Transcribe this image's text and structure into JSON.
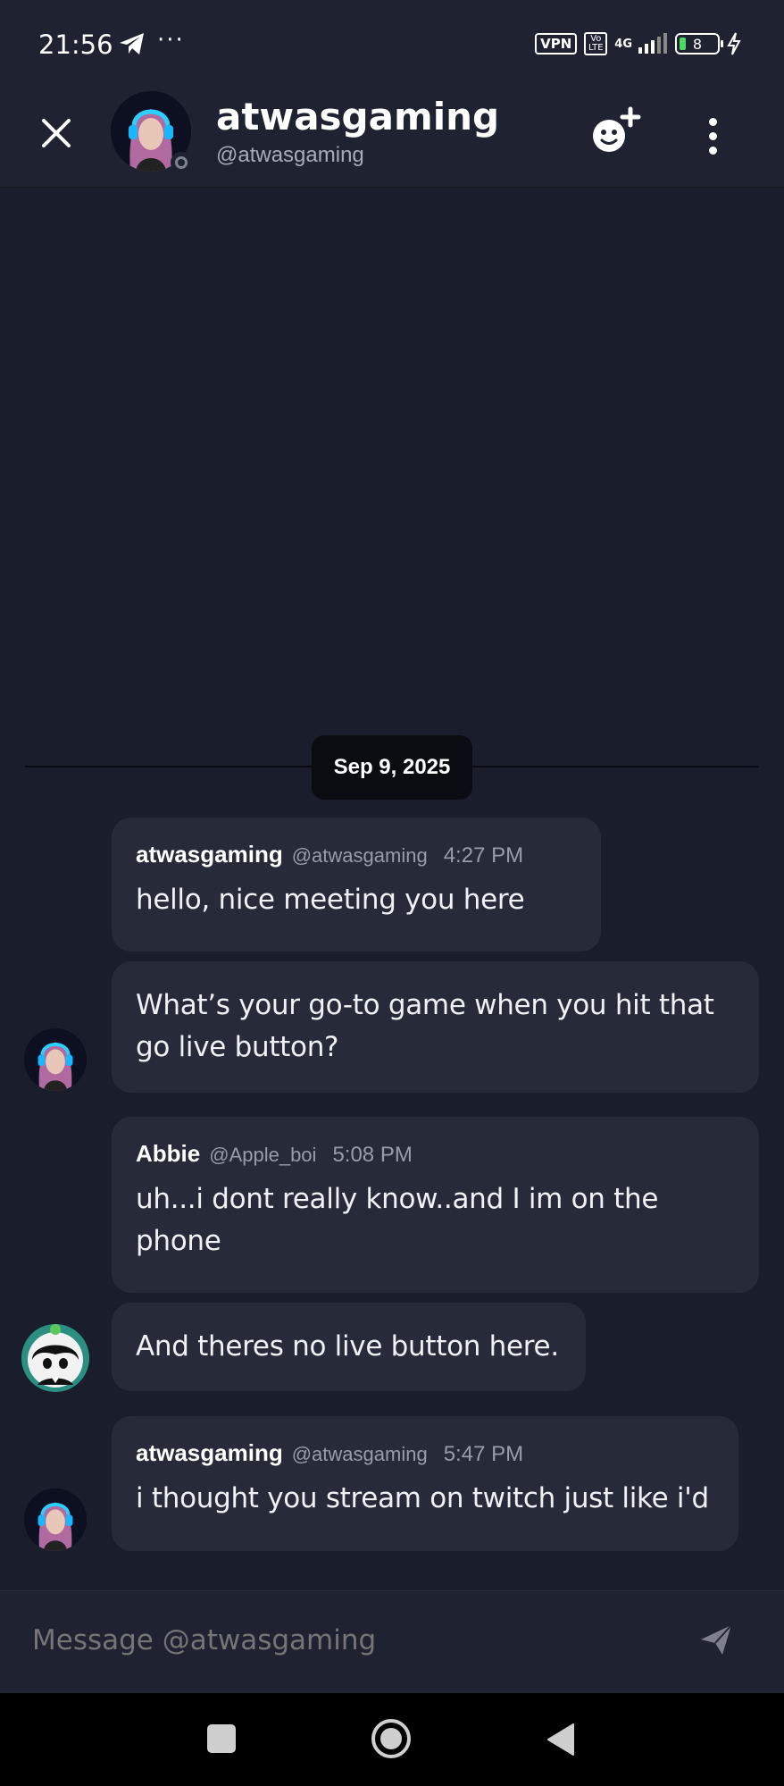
{
  "status_bar": {
    "time": "21:56",
    "overflow": "···",
    "vpn": "VPN",
    "volte": "Vo LTE",
    "network": "4G",
    "battery": "8"
  },
  "header": {
    "display_name": "atwasgaming",
    "handle": "@atwasgaming",
    "presence": "offline"
  },
  "conversation": {
    "date_divider": "Sep 9, 2025",
    "groups": [
      {
        "author": "atwasgaming",
        "handle": "@atwasgaming",
        "time": "4:27 PM",
        "messages": [
          "hello, nice meeting you here",
          "What’s your go-to game when you hit that go live button?"
        ]
      },
      {
        "author": "Abbie",
        "handle": "@Apple_boi",
        "time": "5:08 PM",
        "messages": [
          "uh...i dont really know..and I im on the phone",
          "And theres no live button here."
        ]
      },
      {
        "author": "atwasgaming",
        "handle": "@atwasgaming",
        "time": "5:47 PM",
        "messages": [
          "i thought you stream on twitch just like i'd"
        ]
      }
    ]
  },
  "composer": {
    "placeholder": "Message @atwasgaming"
  },
  "colors": {
    "background": "#1a1d2b",
    "bubble": "#272a39",
    "header": "#1f2230"
  },
  "icons": [
    "telegram-icon",
    "close-icon",
    "add-friend-icon",
    "more-vertical-icon",
    "send-icon",
    "recents-icon",
    "home-icon",
    "back-icon"
  ]
}
